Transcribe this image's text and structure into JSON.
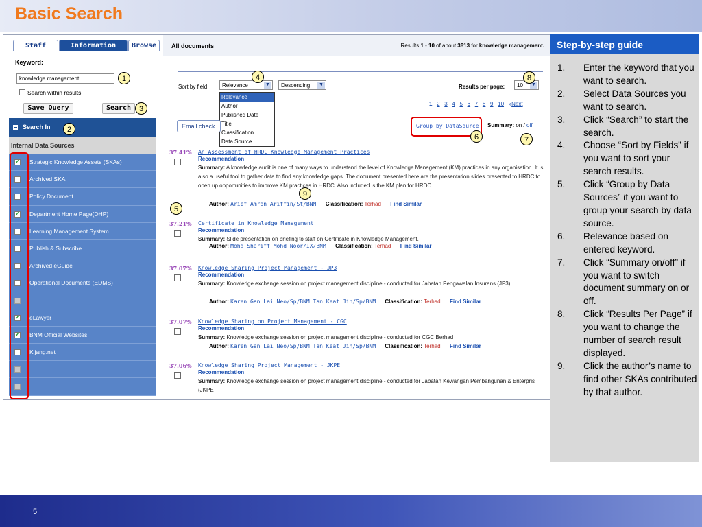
{
  "slide": {
    "title": "Basic Search",
    "page_number": "5"
  },
  "left": {
    "tabs": [
      "Staff",
      "Information",
      "Browse"
    ],
    "keyword_label": "Keyword:",
    "keyword_value": "knowledge management",
    "within_label": "Search within results",
    "save_query": "Save Query",
    "search": "Search",
    "search_in": "Search In",
    "internal_header": "Internal Data Sources",
    "sources": [
      {
        "label": "Strategic Knowledge Assets (SKAs)",
        "checked": true
      },
      {
        "label": "Archived SKA",
        "checked": false
      },
      {
        "label": "Policy Document",
        "checked": false
      },
      {
        "label": "Department Home Page(DHP)",
        "checked": true
      },
      {
        "label": "Learning Management System",
        "checked": false
      },
      {
        "label": "Publish & Subscribe",
        "checked": false
      },
      {
        "label": "Archived eGuide",
        "checked": false
      },
      {
        "label": "Operational Documents (EDMS)",
        "checked": false
      },
      {
        "label": "",
        "checked": false,
        "disabled": true
      },
      {
        "label": "eLawyer",
        "checked": true
      },
      {
        "label": "BNM Official Websites",
        "checked": true
      },
      {
        "label": "Kijang.net",
        "checked": false
      },
      {
        "label": "",
        "checked": false,
        "disabled": true
      },
      {
        "label": "",
        "checked": false,
        "disabled": true
      }
    ]
  },
  "right": {
    "all_documents": "All documents",
    "results_summary": {
      "prefix": "Results ",
      "from": "1",
      "dash": " - ",
      "to": "10",
      "of_about": " of about ",
      "total": "3813",
      "for": " for ",
      "query": "knowledge management."
    },
    "sort_label": "Sort by field:",
    "sort_value": "Relevance",
    "order_value": "Descending",
    "per_page_label": "Results per page:",
    "per_page_value": "10",
    "sort_options": [
      "Relevance",
      "Author",
      "Published Date",
      "Title",
      "Classification",
      "Data Source"
    ],
    "pages": [
      "1",
      "2",
      "3",
      "4",
      "5",
      "6",
      "7",
      "8",
      "9",
      "10"
    ],
    "next_label": "Next",
    "email_label": "Email check",
    "group_label": "Group by DataSource",
    "summary_label": "Summary:",
    "summary_on": "on",
    "summary_sep": " / ",
    "summary_off": "off",
    "results": [
      {
        "score": "37.41%",
        "title": "An Assessment of HRDC Knowledge Management Practices",
        "rec": "Recommendation",
        "summary_label": "Summary:",
        "summary": "A knowledge audit is one of many ways to understand the level of Knowledge Management (KM) practices in any organisation. It is also a useful tool to gather data to find any knowledge gaps. The document presented here are the presentation slides presented to HRDC to open up opportunities to improve KM practices in HRDC. Also included is the KM plan for HRDC.",
        "author_label": "Author:",
        "authors": "Arief Amron Ariffin/St/BNM",
        "class_label": "Classification:",
        "classification": "Terhad",
        "find_similar": "Find Similar"
      },
      {
        "score": "37.21%",
        "title": "Certificate in Knowledge Management",
        "rec": "Recommendation",
        "summary_label": "Summary:",
        "summary": "Slide presentation on briefing to staff on Certificate in Knowledge Management.",
        "author_label": "Author:",
        "authors": "Mohd Shariff Mohd Noor/IX/BNM",
        "class_label": "Classification:",
        "classification": "Terhad",
        "find_similar": "Find Similar"
      },
      {
        "score": "37.07%",
        "title": "Knowledge Sharing Project Management - JP3",
        "rec": "Recommendation",
        "summary_label": "Summary:",
        "summary": "Knowledge exchange session on project management discipline - conducted for Jabatan Pengawalan Insurans (JP3)",
        "author_label": "Author:",
        "authors": "Karen Gan Lai Neo/Sp/BNM     Tan Keat Jin/Sp/BNM",
        "class_label": "Classification:",
        "classification": "Terhad",
        "find_similar": "Find Similar"
      },
      {
        "score": "37.07%",
        "title": "Knowledge Sharing on Project Management - CGC",
        "rec": "Recommendation",
        "summary_label": "Summary:",
        "summary": "Knowledge exchange session on project management discipline - conducted for CGC Berhad",
        "author_label": "Author:",
        "authors": "Karen Gan Lai Neo/Sp/BNM     Tan Keat Jin/Sp/BNM",
        "class_label": "Classification:",
        "classification": "Terhad",
        "find_similar": "Find Similar"
      },
      {
        "score": "37.06%",
        "title": "Knowledge Sharing Project Management - JKPE",
        "rec": "Recommendation",
        "summary_label": "Summary:",
        "summary": "Knowledge exchange session on project management discipline - conducted for Jabatan Kewangan Pembangunan & Enterpris (JKPE",
        "author_label": "",
        "authors": "",
        "class_label": "",
        "classification": "",
        "find_similar": ""
      }
    ]
  },
  "callouts": [
    "1",
    "2",
    "3",
    "4",
    "5",
    "6",
    "7",
    "8",
    "9"
  ],
  "guide": {
    "title": "Step-by-step guide",
    "steps": [
      {
        "num": "1.",
        "text": "Enter the keyword that you want to search."
      },
      {
        "num": "2.",
        "text": "Select Data Sources you want to search."
      },
      {
        "num": "3.",
        "text": "Click “Search” to start the search."
      },
      {
        "num": "4.",
        "text": "Choose “Sort by Fields” if you want to sort your search results."
      },
      {
        "num": "5.",
        "text": "Click “Group by Data Sources” if you want to group your search by data source."
      },
      {
        "num": "6.",
        "text": "Relevance based on entered keyword."
      },
      {
        "num": "7.",
        "text": "Click “Summary on/off” if you want to switch document summary on or off."
      },
      {
        "num": "8.",
        "text": "Click “Results Per Page” if you want to change the number of search result displayed."
      },
      {
        "num": "9.",
        "text": "Click the author’s name to find other SKAs contributed by that author."
      }
    ]
  },
  "colors": {
    "title_orange": "#f07a1e",
    "panel_blue": "#5884c8",
    "header_blue": "#1b5cc4",
    "highlight_red": "#e00000"
  }
}
